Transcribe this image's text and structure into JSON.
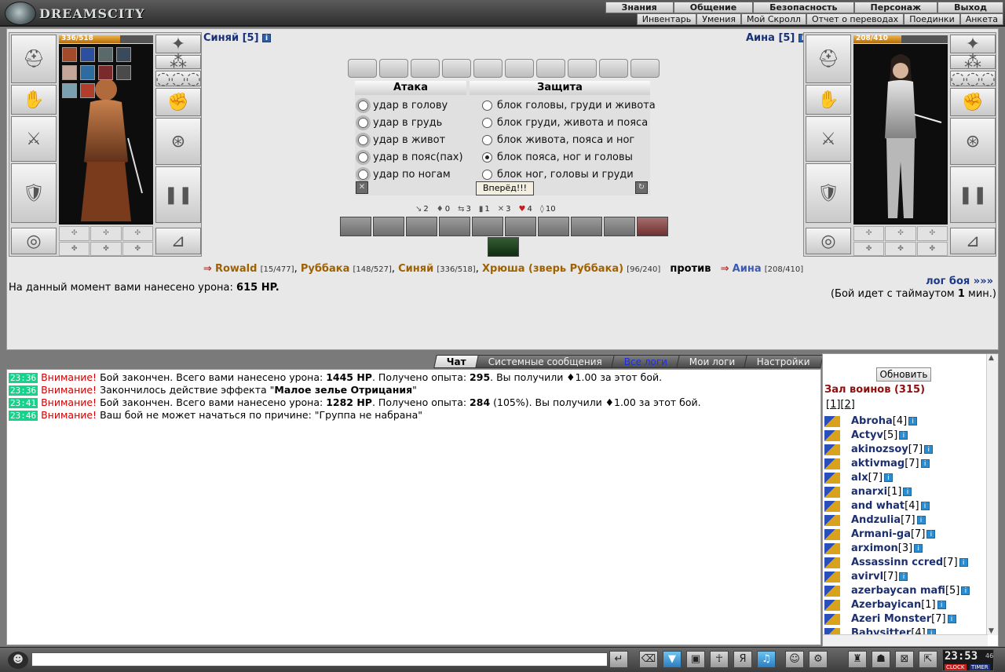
{
  "logo": {
    "text": "DREAMSCITY"
  },
  "top_menu": [
    "Знания",
    "Общение",
    "Безопасность",
    "Персонаж",
    "Выход"
  ],
  "sub_menu": [
    "Инвентарь",
    "Умения",
    "Мой Скролл",
    "Отчет о переводах",
    "Поединки",
    "Анкета"
  ],
  "left_player": {
    "name": "Синяй [5]",
    "hp_text": "336/518",
    "hp_fraction": 0.65
  },
  "right_player": {
    "name": "Аина [5]",
    "hp_text": "208/410",
    "hp_fraction": 0.51
  },
  "attack": {
    "header": "Атака",
    "options": [
      "удар в голову",
      "удар в грудь",
      "удар в живот",
      "удар в пояс(пах)",
      "удар по ногам"
    ]
  },
  "defense": {
    "header": "Защита",
    "options": [
      "блок головы, груди и живота",
      "блок груди, живота и пояса",
      "блок живота, пояса и ног",
      "блок пояса, ног и головы",
      "блок ног, головы и груди"
    ],
    "selected_index": 3
  },
  "go_button": "Вперёд!!!",
  "stats": [
    "2",
    "0",
    "3",
    "1",
    "3",
    "4",
    "10"
  ],
  "versus": {
    "team1": [
      {
        "name": "Rowald",
        "hp": "[15/477]"
      },
      {
        "name": "Руббака",
        "hp": "[148/527]"
      },
      {
        "name": "Синяй",
        "hp": "[336/518]"
      },
      {
        "name": "Хрюша (зверь Руббака)",
        "hp": "[96/240]"
      }
    ],
    "vs": "против",
    "team2": [
      {
        "name": "Аина",
        "hp": "[208/410]"
      }
    ]
  },
  "damage_line": {
    "prefix": "На данный момент вами нанесено урона:",
    "value": "615 HP."
  },
  "log_link": "лог боя »»»",
  "timeout": {
    "prefix": "(Бой идет с таймаутом",
    "value": "1",
    "suffix": "мин.)"
  },
  "chat_tabs": [
    {
      "label": "Чат",
      "active": true
    },
    {
      "label": "Системные сообщения",
      "active": false
    },
    {
      "label": "Все логи",
      "active": false,
      "blue": true
    },
    {
      "label": "Мои логи",
      "active": false
    },
    {
      "label": "Настройки",
      "active": false
    }
  ],
  "messages": [
    {
      "time": "23:36",
      "warn": "Внимание!",
      "text1": "Бой закончен. Всего вами нанесено урона:",
      "b1": "1445 HP",
      "text2": ". Получено опыта:",
      "b2": "295",
      "text3": ". Вы получили ♦1.00 за этот бой."
    },
    {
      "time": "23:36",
      "warn": "Внимание!",
      "text1": "Закончилось действие эффекта \"",
      "b1": "Малое зелье Отрицания",
      "text2": "\"",
      "b2": "",
      "text3": ""
    },
    {
      "time": "23:41",
      "warn": "Внимание!",
      "text1": "Бой закончен. Всего вами нанесено урона:",
      "b1": "1282 HP",
      "text2": ". Получено опыта:",
      "b2": "284",
      "text3": "(105%). Вы получили ♦1.00 за этот бой."
    },
    {
      "time": "23:46",
      "warn": "Внимание!",
      "text1": "Ваш бой не может начаться по причине: \"Группа не набрана\"",
      "b1": "",
      "text2": "",
      "b2": "",
      "text3": ""
    }
  ],
  "sidebar": {
    "refresh": "Обновить",
    "title": "Зал воинов (315)",
    "pages": [
      "1",
      "2"
    ],
    "players": [
      {
        "name": "Abroha",
        "lvl": "[4]"
      },
      {
        "name": "Actyv",
        "lvl": "[5]"
      },
      {
        "name": "akinozsoy",
        "lvl": "[7]"
      },
      {
        "name": "aktivmag",
        "lvl": "[7]"
      },
      {
        "name": "alx",
        "lvl": "[7]"
      },
      {
        "name": "anarxi",
        "lvl": "[1]"
      },
      {
        "name": "and what",
        "lvl": "[4]"
      },
      {
        "name": "Andzulia",
        "lvl": "[7]"
      },
      {
        "name": "Armani-ga",
        "lvl": "[7]"
      },
      {
        "name": "arximon",
        "lvl": "[3]"
      },
      {
        "name": "Assassinn ccred",
        "lvl": "[7]"
      },
      {
        "name": "avirvl",
        "lvl": "[7]"
      },
      {
        "name": "azerbaycan mafi",
        "lvl": "[5]"
      },
      {
        "name": "Azerbayican",
        "lvl": "[1]"
      },
      {
        "name": "Azeri Monster",
        "lvl": "[7]"
      },
      {
        "name": "Babysitter",
        "lvl": "[4]"
      }
    ]
  },
  "clock": {
    "time": "23:53",
    "seconds": "46",
    "label1": "CLOCK",
    "label2": "TIMER"
  },
  "colors": {
    "accent_blue": "#1b2f72",
    "warn_red": "#d00000",
    "time_green": "#14d38a"
  }
}
